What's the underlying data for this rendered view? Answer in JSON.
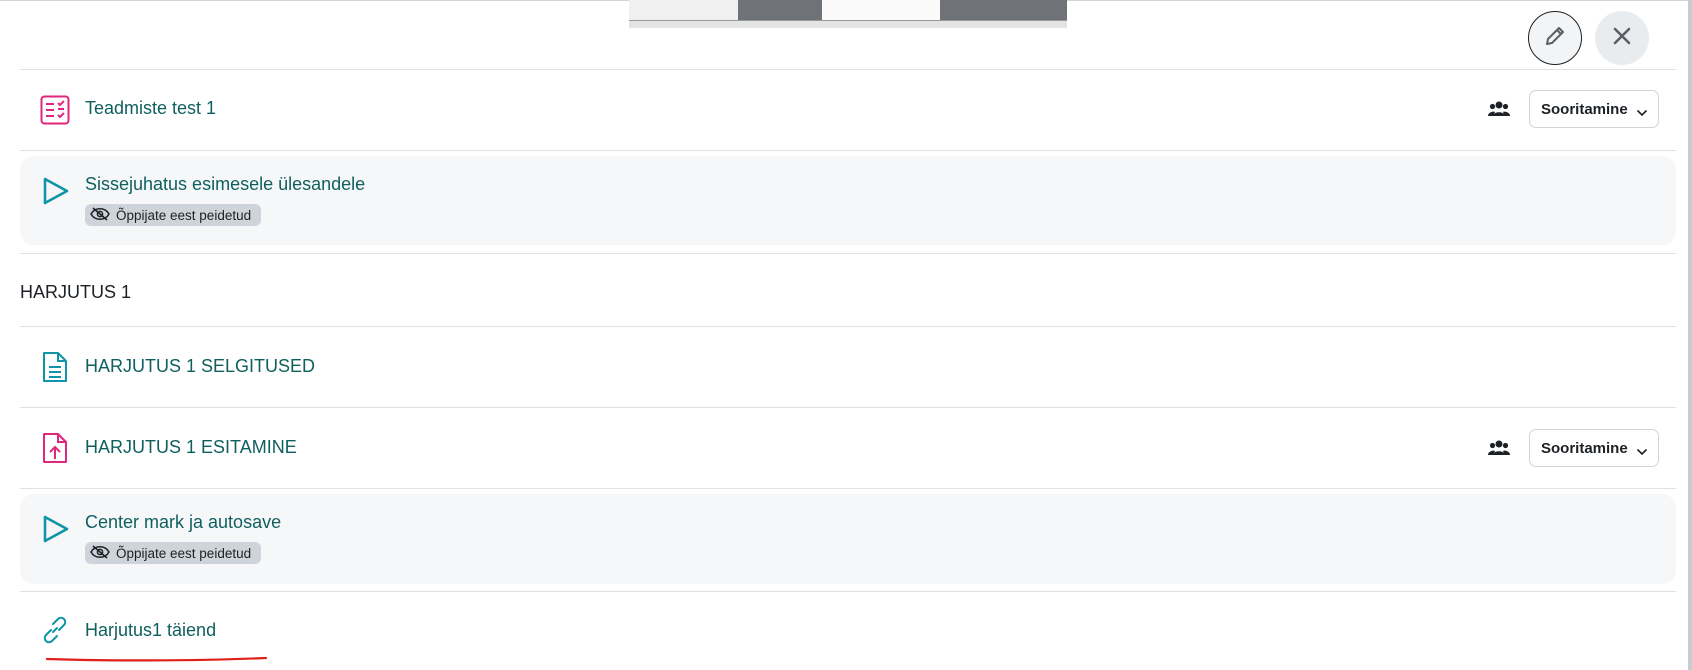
{
  "header": {
    "edit_icon": "pencil-icon",
    "close_icon": "close-icon"
  },
  "activities": [
    {
      "name": "Teadmiste test 1",
      "icon": "quiz-icon",
      "group_mode_icon": "groups-icon",
      "completion_label": "Sooritamine"
    },
    {
      "name": "Sissejuhatus esimesele ülesandele",
      "icon": "video-play-icon",
      "badge": "Õppijate eest peidetud",
      "badge_icon": "eye-slash-icon"
    },
    {
      "name": "HARJUTUS 1 SELGITUSED",
      "icon": "page-icon"
    },
    {
      "name": "HARJUTUS 1 ESITAMINE",
      "icon": "assignment-upload-icon",
      "group_mode_icon": "groups-icon",
      "completion_label": "Sooritamine"
    },
    {
      "name": "Center mark ja autosave",
      "icon": "video-play-icon",
      "badge": "Õppijate eest peidetud",
      "badge_icon": "eye-slash-icon"
    },
    {
      "name": "Harjutus1 täiend",
      "icon": "link-icon"
    }
  ],
  "section": {
    "title": "HARJUTUS 1"
  },
  "colors": {
    "activity_link": "#0f5f5f",
    "quiz_icon": "#e0267d",
    "video_icon": "#0f94a8",
    "badge_bg": "#ced4da",
    "annotation": "#e0201a"
  }
}
